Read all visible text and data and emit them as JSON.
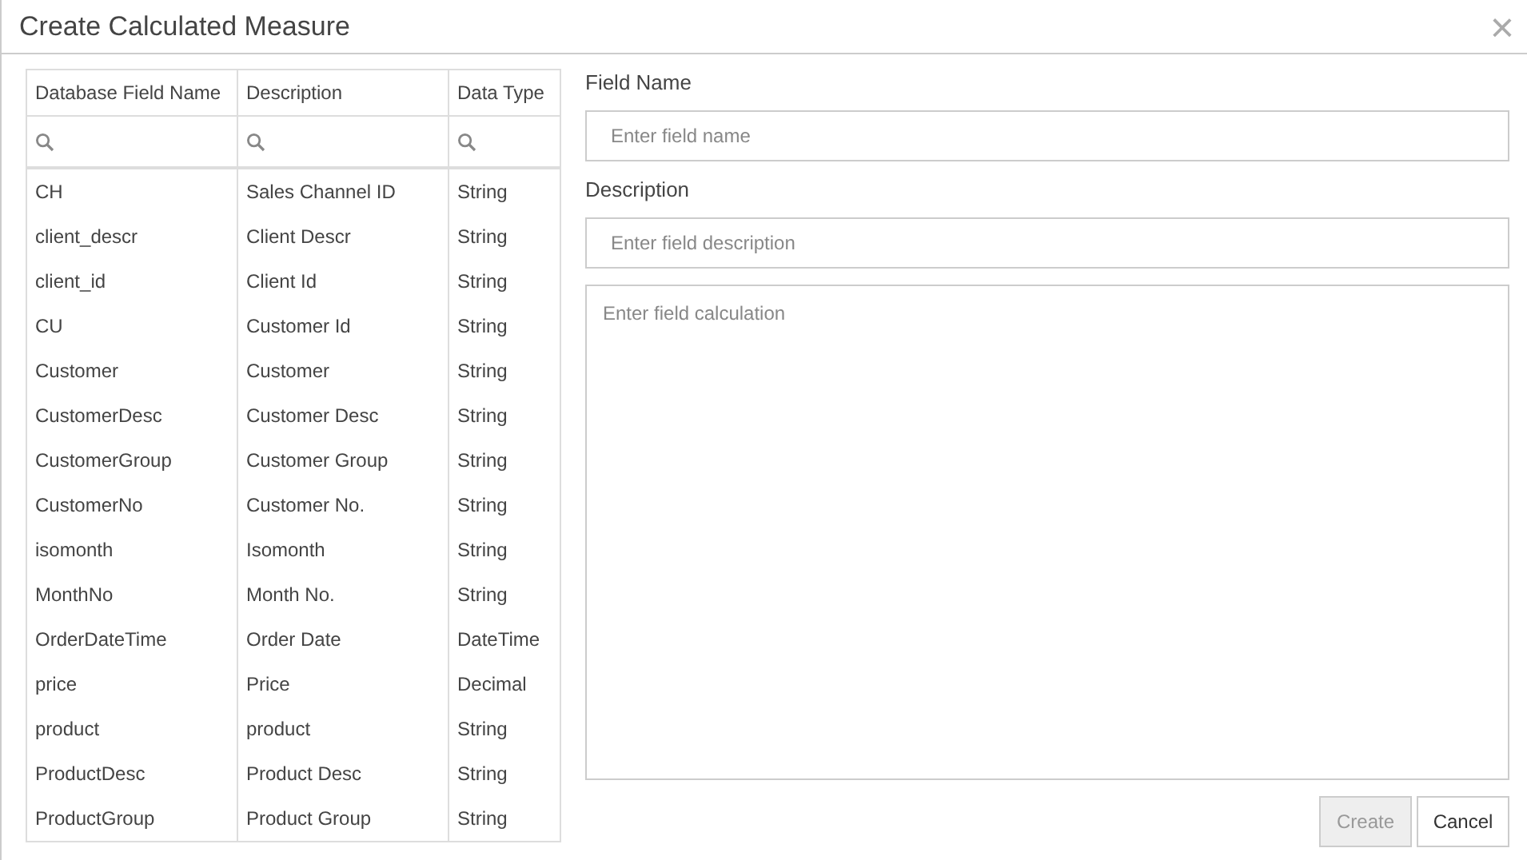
{
  "window": {
    "title": "Create Calculated Measure",
    "close": "×"
  },
  "table": {
    "columns": [
      "Database Field Name",
      "Description",
      "Data Type"
    ],
    "rows": [
      [
        "CH",
        "Sales Channel ID",
        "String"
      ],
      [
        "client_descr",
        "Client Descr",
        "String"
      ],
      [
        "client_id",
        "Client Id",
        "String"
      ],
      [
        "CU",
        "Customer Id",
        "String"
      ],
      [
        "Customer",
        "Customer",
        "String"
      ],
      [
        "CustomerDesc",
        "Customer Desc",
        "String"
      ],
      [
        "CustomerGroup",
        "Customer Group",
        "String"
      ],
      [
        "CustomerNo",
        "Customer No.",
        "String"
      ],
      [
        "isomonth",
        "Isomonth",
        "String"
      ],
      [
        "MonthNo",
        "Month No.",
        "String"
      ],
      [
        "OrderDateTime",
        "Order Date",
        "DateTime"
      ],
      [
        "price",
        "Price",
        "Decimal"
      ],
      [
        "product",
        "product",
        "String"
      ],
      [
        "ProductDesc",
        "Product Desc",
        "String"
      ],
      [
        "ProductGroup",
        "Product Group",
        "String"
      ]
    ]
  },
  "form": {
    "field_name": {
      "label": "Field Name",
      "placeholder": "Enter field name"
    },
    "description": {
      "label": "Description",
      "placeholder": "Enter field description"
    },
    "calculation": {
      "placeholder": "Enter field calculation"
    }
  },
  "buttons": [
    {
      "label": "Create",
      "disabled": true
    },
    {
      "label": "Cancel",
      "disabled": false
    }
  ]
}
